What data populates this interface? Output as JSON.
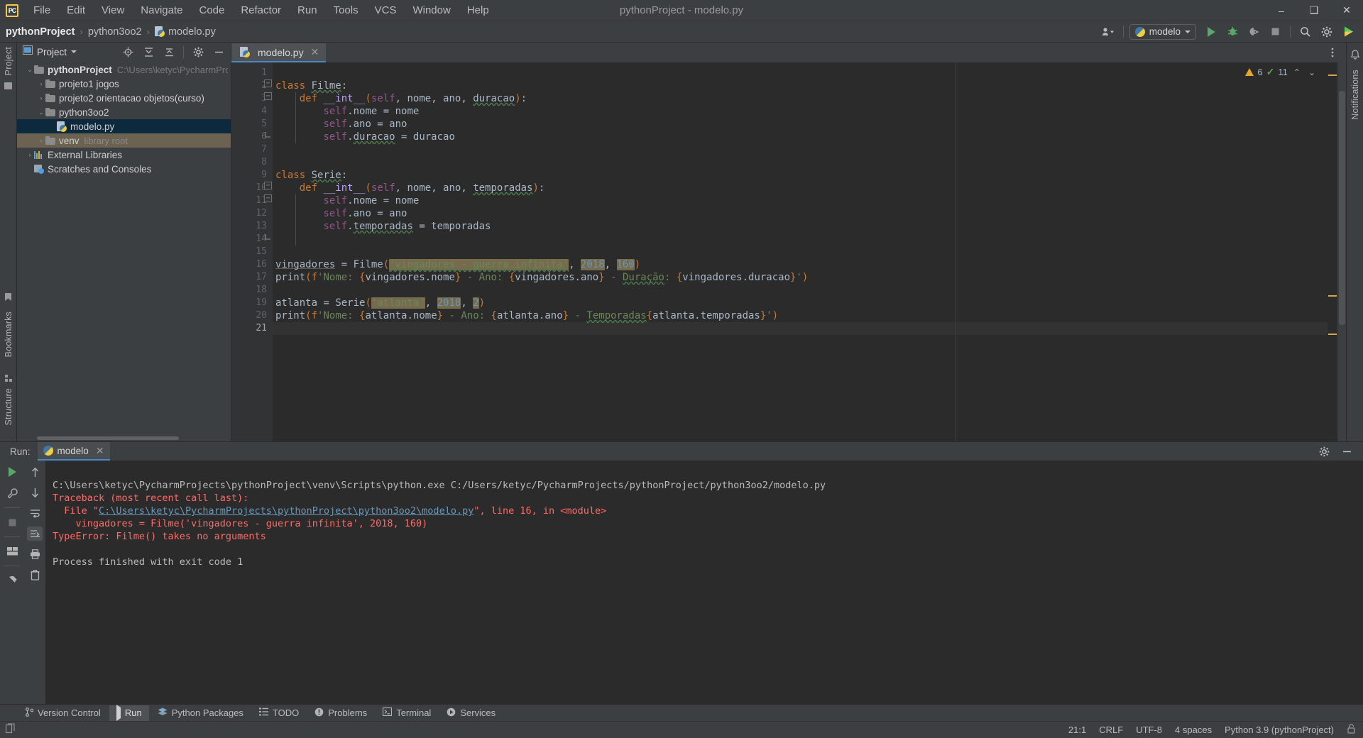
{
  "titlebar": {
    "logo": "PC",
    "menus": [
      "File",
      "Edit",
      "View",
      "Navigate",
      "Code",
      "Refactor",
      "Run",
      "Tools",
      "VCS",
      "Window",
      "Help"
    ],
    "window_title": "pythonProject - modelo.py",
    "minimize": "–",
    "maximize": "❑",
    "close": "✕"
  },
  "navbar": {
    "breadcrumbs": [
      "pythonProject",
      "python3oo2",
      "modelo.py"
    ],
    "separator": "›",
    "run_config": "modelo",
    "icons": {
      "account": "account-icon",
      "run": "run-icon",
      "debug": "debug-icon",
      "coverage": "coverage-icon",
      "stop": "stop-icon",
      "search": "search-icon",
      "settings": "gear-icon",
      "updates": "updates-icon"
    }
  },
  "left_strip": {
    "project_label": "Project",
    "bookmarks_label": "Bookmarks",
    "structure_label": "Structure"
  },
  "right_strip": {
    "notifications_label": "Notifications"
  },
  "project_panel": {
    "title": "Project",
    "tree": [
      {
        "label": "pythonProject",
        "path": "C:\\Users\\ketyc\\PycharmProjects\\",
        "depth": 0,
        "arrow": "⌄",
        "bold": true,
        "icon": "folder-icon",
        "state": "none"
      },
      {
        "label": "projeto1 jogos",
        "path": "",
        "depth": 1,
        "arrow": "›",
        "bold": false,
        "icon": "folder-icon",
        "state": "none"
      },
      {
        "label": "projeto2 orientacao objetos(curso)",
        "path": "",
        "depth": 1,
        "arrow": "›",
        "bold": false,
        "icon": "folder-icon",
        "state": "none"
      },
      {
        "label": "python3oo2",
        "path": "",
        "depth": 1,
        "arrow": "⌄",
        "bold": false,
        "icon": "folder-icon",
        "state": "none"
      },
      {
        "label": "modelo.py",
        "path": "",
        "depth": 2,
        "arrow": "",
        "bold": false,
        "icon": "python-file-icon",
        "state": "selected"
      },
      {
        "label": "venv",
        "path": "library root",
        "depth": 1,
        "arrow": "›",
        "bold": false,
        "icon": "folder-icon",
        "state": "highlight"
      },
      {
        "label": "External Libraries",
        "path": "",
        "depth": 0,
        "arrow": "›",
        "bold": false,
        "icon": "library-icon",
        "state": "none"
      },
      {
        "label": "Scratches and Consoles",
        "path": "",
        "depth": 0,
        "arrow": "",
        "bold": false,
        "icon": "scratch-icon",
        "state": "none"
      }
    ]
  },
  "editor": {
    "tab": {
      "label": "modelo.py",
      "close": "✕",
      "icon": "python-file-icon"
    },
    "inspection": {
      "warnings": "6",
      "checks": "11",
      "up": "⌃",
      "down": "⌄"
    },
    "total_lines": 21,
    "current_line": 21,
    "lines": [
      {
        "n": 1,
        "text": ""
      },
      {
        "n": 2,
        "text": "class Filme:"
      },
      {
        "n": 3,
        "text": "    def __int__(self, nome, ano, duracao):"
      },
      {
        "n": 4,
        "text": "        self.nome = nome"
      },
      {
        "n": 5,
        "text": "        self.ano = ano"
      },
      {
        "n": 6,
        "text": "        self.duracao = duracao"
      },
      {
        "n": 7,
        "text": ""
      },
      {
        "n": 8,
        "text": ""
      },
      {
        "n": 9,
        "text": "class Serie:"
      },
      {
        "n": 10,
        "text": "    def __int__(self, nome, ano, temporadas):"
      },
      {
        "n": 11,
        "text": "        self.nome = nome"
      },
      {
        "n": 12,
        "text": "        self.ano = ano"
      },
      {
        "n": 13,
        "text": "        self.temporadas = temporadas"
      },
      {
        "n": 14,
        "text": ""
      },
      {
        "n": 15,
        "text": ""
      },
      {
        "n": 16,
        "text": "vingadores = Filme('vingadores - guerra infinita', 2018, 160)"
      },
      {
        "n": 17,
        "text": "print(f'Nome: {vingadores.nome} - Ano: {vingadores.ano} - Duração: {vingadores.duracao}')"
      },
      {
        "n": 18,
        "text": ""
      },
      {
        "n": 19,
        "text": "atlanta = Serie('atlanta', 2018, 2)"
      },
      {
        "n": 20,
        "text": "print(f'Nome: {atlanta.nome} - Ano: {atlanta.ano} - Temporadas{atlanta.temporadas}')"
      },
      {
        "n": 21,
        "text": ""
      }
    ]
  },
  "run_panel": {
    "label": "Run:",
    "tab": "modelo",
    "tab_close": "✕",
    "toolbar_icons": [
      "rerun-icon",
      "wrench-icon",
      "stop-icon",
      "layout-icon",
      "pin-icon"
    ],
    "toolbar_icons2": [
      "arrow-up-icon",
      "arrow-down-icon",
      "soft-wrap-icon",
      "scroll-to-end-icon",
      "print-icon",
      "trash-icon"
    ],
    "console": [
      {
        "type": "out",
        "text": "C:\\Users\\ketyc\\PycharmProjects\\pythonProject\\venv\\Scripts\\python.exe C:/Users/ketyc/PycharmProjects/pythonProject/python3oo2/modelo.py"
      },
      {
        "type": "err",
        "text": "Traceback (most recent call last):"
      },
      {
        "type": "err-link",
        "prefix": "  File \"",
        "link": "C:\\Users\\ketyc\\PycharmProjects\\pythonProject\\python3oo2\\modelo.py",
        "suffix": "\", line 16, in <module>"
      },
      {
        "type": "err",
        "text": "    vingadores = Filme('vingadores - guerra infinita', 2018, 160)"
      },
      {
        "type": "err",
        "text": "TypeError: Filme() takes no arguments"
      },
      {
        "type": "out",
        "text": ""
      },
      {
        "type": "out",
        "text": "Process finished with exit code 1"
      }
    ]
  },
  "toolwindow_bar": [
    {
      "label": "Version Control",
      "icon": "branch-icon",
      "active": false
    },
    {
      "label": "Run",
      "icon": "run-icon",
      "active": true
    },
    {
      "label": "Python Packages",
      "icon": "packages-icon",
      "active": false
    },
    {
      "label": "TODO",
      "icon": "todo-icon",
      "active": false
    },
    {
      "label": "Problems",
      "icon": "problems-icon",
      "active": false
    },
    {
      "label": "Terminal",
      "icon": "terminal-icon",
      "active": false
    },
    {
      "label": "Services",
      "icon": "services-icon",
      "active": false
    }
  ],
  "statusbar": {
    "left_icon": "copy-icon",
    "caret": "21:1",
    "line_sep": "CRLF",
    "encoding": "UTF-8",
    "indent": "4 spaces",
    "interpreter": "Python 3.9 (pythonProject)",
    "lock_icon": "↰"
  },
  "colors": {
    "bg": "#3c3f41",
    "editor_bg": "#2b2b2b",
    "accent": "#4a88c7",
    "error": "#ff6b68",
    "string": "#6a8759",
    "keyword": "#cc7832",
    "number": "#6897bb",
    "selection": "#0d293e",
    "highlight": "#766c4d"
  }
}
